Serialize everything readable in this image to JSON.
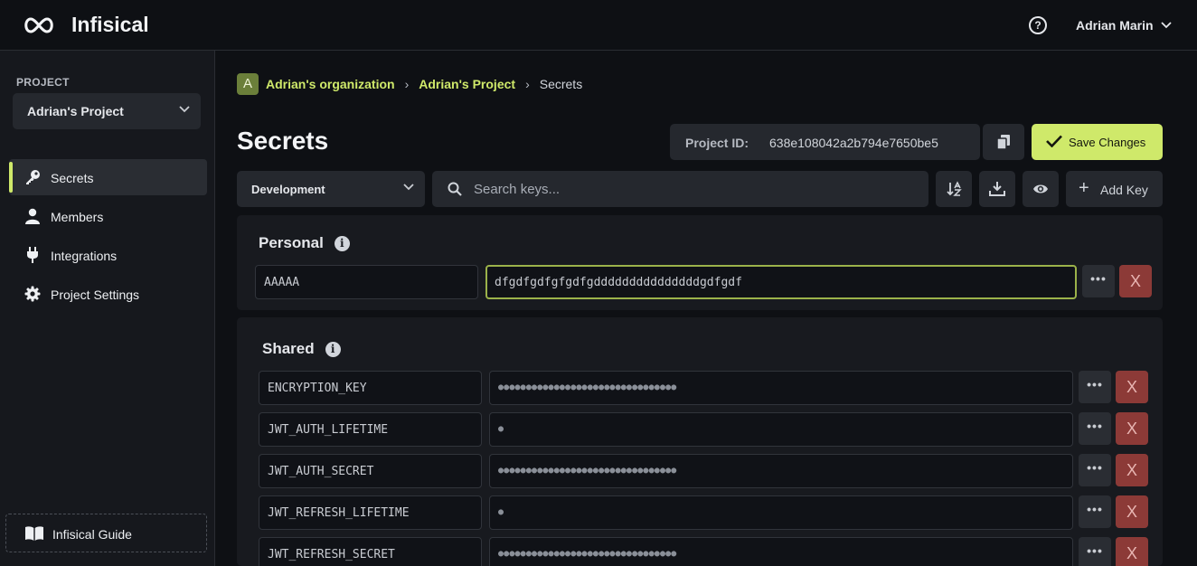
{
  "app": {
    "name": "Infisical"
  },
  "header": {
    "user_name": "Adrian Marin",
    "help_glyph": "?"
  },
  "sidebar": {
    "project_label": "PROJECT",
    "project_name": "Adrian's Project",
    "items": [
      {
        "label": "Secrets",
        "icon": "key-icon",
        "active": true
      },
      {
        "label": "Members",
        "icon": "user-icon",
        "active": false
      },
      {
        "label": "Integrations",
        "icon": "plug-icon",
        "active": false
      },
      {
        "label": "Project Settings",
        "icon": "gear-icon",
        "active": false
      }
    ],
    "guide_label": "Infisical Guide"
  },
  "breadcrumb": {
    "org_initial": "A",
    "org": "Adrian's organization",
    "project": "Adrian's Project",
    "current": "Secrets"
  },
  "page": {
    "title": "Secrets",
    "project_id_label": "Project ID:",
    "project_id": "638e108042a2b794e7650be5",
    "save_label": "Save Changes"
  },
  "toolbar": {
    "environment": "Development",
    "search_placeholder": "Search keys...",
    "add_key_label": "Add Key",
    "plus": "+"
  },
  "personal": {
    "title": "Personal",
    "secrets": [
      {
        "key": "AAAAA",
        "value": "dfgdfgdfgfgdfgdddddddddddddddgdfgdf"
      }
    ]
  },
  "shared": {
    "title": "Shared",
    "secrets": [
      {
        "key": "ENCRYPTION_KEY",
        "value": "●●●●●●●●●●●●●●●●●●●●●●●●●●●●●●●●"
      },
      {
        "key": "JWT_AUTH_LIFETIME",
        "value": "●"
      },
      {
        "key": "JWT_AUTH_SECRET",
        "value": "●●●●●●●●●●●●●●●●●●●●●●●●●●●●●●●●"
      },
      {
        "key": "JWT_REFRESH_LIFETIME",
        "value": "●"
      },
      {
        "key": "JWT_REFRESH_SECRET",
        "value": "●●●●●●●●●●●●●●●●●●●●●●●●●●●●●●●●"
      }
    ]
  },
  "row_actions": {
    "more": "•••",
    "delete": "X"
  },
  "colors": {
    "accent": "#cfe96a",
    "danger": "#8c3a37",
    "background": "#0e1014"
  }
}
